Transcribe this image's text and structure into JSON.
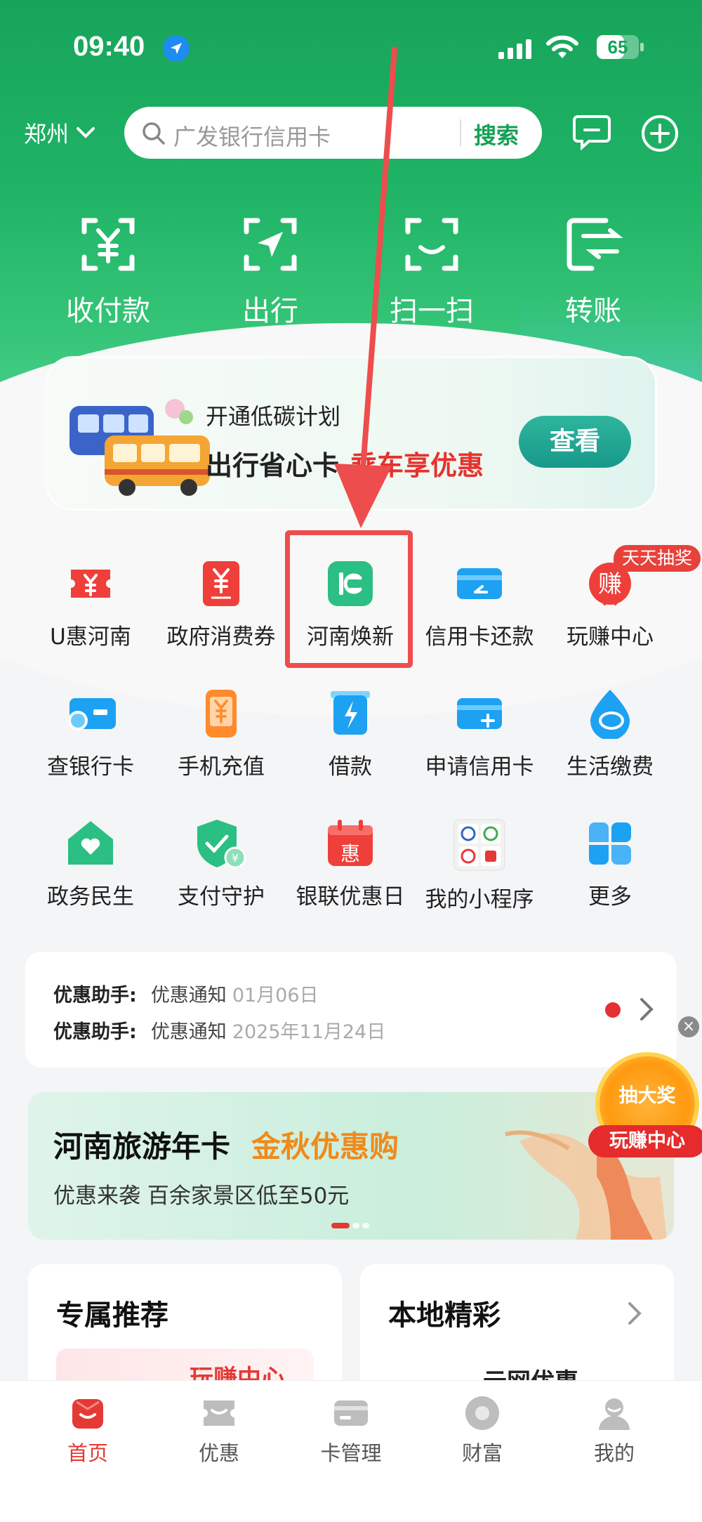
{
  "status_bar": {
    "time": "09:40",
    "battery": "65",
    "battery_level": 0.65
  },
  "header": {
    "city": "郑州",
    "search_placeholder": "广发银行信用卡",
    "search_button": "搜索"
  },
  "quick_actions": [
    {
      "label": "收付款",
      "icon": "yuan-scan-icon"
    },
    {
      "label": "出行",
      "icon": "navigation-icon"
    },
    {
      "label": "扫一扫",
      "icon": "scan-icon"
    },
    {
      "label": "转账",
      "icon": "transfer-icon"
    }
  ],
  "promo": {
    "subtitle": "开通低碳计划",
    "title": "出行省心卡",
    "highlight": "乘车享优惠",
    "button": "查看"
  },
  "services": [
    {
      "label": "U惠河南",
      "icon": "coupon-icon"
    },
    {
      "label": "政府消费券",
      "icon": "voucher-icon"
    },
    {
      "label": "河南焕新",
      "icon": "renew-icon"
    },
    {
      "label": "信用卡还款",
      "icon": "card-repay-icon"
    },
    {
      "label": "玩赚中心",
      "icon": "earn-icon"
    },
    {
      "label": "查银行卡",
      "icon": "card-search-icon"
    },
    {
      "label": "手机充值",
      "icon": "phone-topup-icon"
    },
    {
      "label": "借款",
      "icon": "loan-icon"
    },
    {
      "label": "申请信用卡",
      "icon": "card-apply-icon"
    },
    {
      "label": "生活缴费",
      "icon": "water-drop-icon"
    },
    {
      "label": "政务民生",
      "icon": "home-heart-icon"
    },
    {
      "label": "支付守护",
      "icon": "shield-icon"
    },
    {
      "label": "银联优惠日",
      "icon": "calendar-icon"
    },
    {
      "label": "我的小程序",
      "icon": "mini-program-icon"
    },
    {
      "label": "更多",
      "icon": "more-grid-icon"
    }
  ],
  "badge": "天天抽奖",
  "notifications": [
    {
      "key": "优惠助手:",
      "type": "优惠通知",
      "date": "01月06日"
    },
    {
      "key": "优惠助手:",
      "type": "优惠通知",
      "date": "2025年11月24日"
    }
  ],
  "banner": {
    "title": "河南旅游年卡",
    "highlight": "金秋优惠购",
    "subtitle": "优惠来袭 百余家景区低至50元"
  },
  "lottery": {
    "top": "抽大奖",
    "bottom": "玩赚中心"
  },
  "cards": {
    "left_title": "专属推荐",
    "left_text": "玩赚中心",
    "right_title": "本地精彩",
    "right_text": "云网优惠"
  },
  "tabbar": [
    {
      "label": "首页",
      "active": true
    },
    {
      "label": "优惠",
      "active": false
    },
    {
      "label": "卡管理",
      "active": false
    },
    {
      "label": "财富",
      "active": false
    },
    {
      "label": "我的",
      "active": false
    }
  ],
  "colors": {
    "brand_green": "#1fb366",
    "accent_red": "#e53935",
    "annotation_red": "#ee4d4d"
  }
}
